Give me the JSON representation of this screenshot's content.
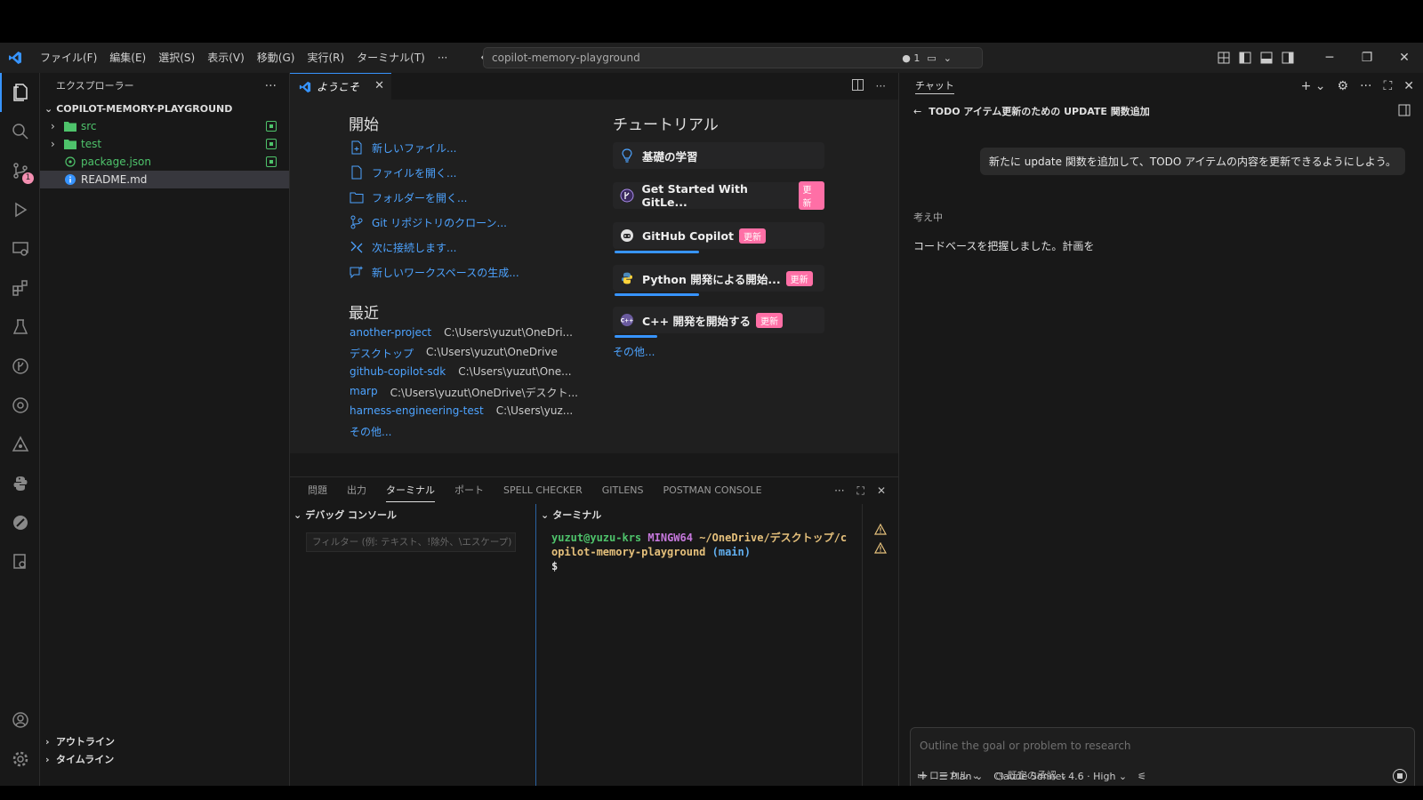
{
  "menu": [
    "ファイル(F)",
    "編集(E)",
    "選択(S)",
    "表示(V)",
    "移動(G)",
    "実行(R)",
    "ターミナル(T)",
    "···"
  ],
  "command_center": {
    "text": "copilot-memory-playground",
    "indicator": "● 1"
  },
  "activity": {
    "scm_badge": "1"
  },
  "explorer": {
    "title": "エクスプローラー",
    "root": "COPILOT-MEMORY-PLAYGROUND",
    "items": [
      {
        "label": "src",
        "type": "folder"
      },
      {
        "label": "test",
        "type": "folder"
      },
      {
        "label": "package.json",
        "type": "json"
      },
      {
        "label": "README.md",
        "type": "md"
      }
    ],
    "outline": "アウトライン",
    "timeline": "タイムライン"
  },
  "editor": {
    "tab_label": "ようこそ",
    "start": {
      "heading": "開始",
      "items": [
        "新しいファイル...",
        "ファイルを開く...",
        "フォルダーを開く...",
        "Git リポジトリのクローン...",
        "次に接続します...",
        "新しいワークスペースの生成..."
      ]
    },
    "recent": {
      "heading": "最近",
      "items": [
        {
          "name": "another-project",
          "path": "C:\\Users\\yuzut\\OneDri..."
        },
        {
          "name": "デスクトップ",
          "path": "C:\\Users\\yuzut\\OneDrive"
        },
        {
          "name": "github-copilot-sdk",
          "path": "C:\\Users\\yuzut\\One..."
        },
        {
          "name": "marp",
          "path": "C:\\Users\\yuzut\\OneDrive\\デスクト..."
        },
        {
          "name": "harness-engineering-test",
          "path": "C:\\Users\\yuz..."
        }
      ],
      "more": "その他..."
    },
    "tutorials": {
      "heading": "チュートリアル",
      "items": [
        {
          "label": "基礎の学習",
          "badge": "",
          "progress": 0
        },
        {
          "label": "Get Started With GitLe...",
          "badge": "更新",
          "progress": 0
        },
        {
          "label": "GitHub Copilot",
          "badge": "更新",
          "progress": 0.4
        },
        {
          "label": "Python 開発による開始...",
          "badge": "更新",
          "progress": 0.4
        },
        {
          "label": "C++ 開発を開始する",
          "badge": "更新",
          "progress": 0.2
        }
      ],
      "more": "その他..."
    }
  },
  "panel": {
    "tabs": [
      "問題",
      "出力",
      "ターミナル",
      "ポート",
      "SPELL CHECKER",
      "GITLENS",
      "POSTMAN CONSOLE"
    ],
    "active_tab": "ターミナル",
    "debug_title": "デバッグ コンソール",
    "filter_placeholder": "フィルター (例: テキスト、!除外、\\エスケープ)",
    "terminal_title": "ターミナル",
    "terminal": {
      "user": "yuzut@yuzu-krs",
      "shell": "MINGW64",
      "path_line1": "~/OneDrive/デスクトップ/c",
      "path_line2": "opilot-memory-playground",
      "branch": "(main)",
      "prompt": "$"
    }
  },
  "chat": {
    "title": "チャット",
    "session_title": "TODO アイテム更新のための UPDATE 関数追加",
    "user_message": "新たに update 関数を追加して、TODO アイテムの内容を更新できるようにしよう。",
    "status": "考え中",
    "reply": "コードベースを把握しました。計画を",
    "input_placeholder": "Outline the goal or problem to research",
    "mode": "Plan",
    "model": "Claude Sonnet 4.6 · High",
    "location": "ローカル",
    "approval": "既定の承認"
  },
  "colors": {
    "accent": "#3794ff",
    "link": "#4da3ff",
    "new_badge": "#ff6fa6",
    "git_added": "#4ec36b"
  }
}
